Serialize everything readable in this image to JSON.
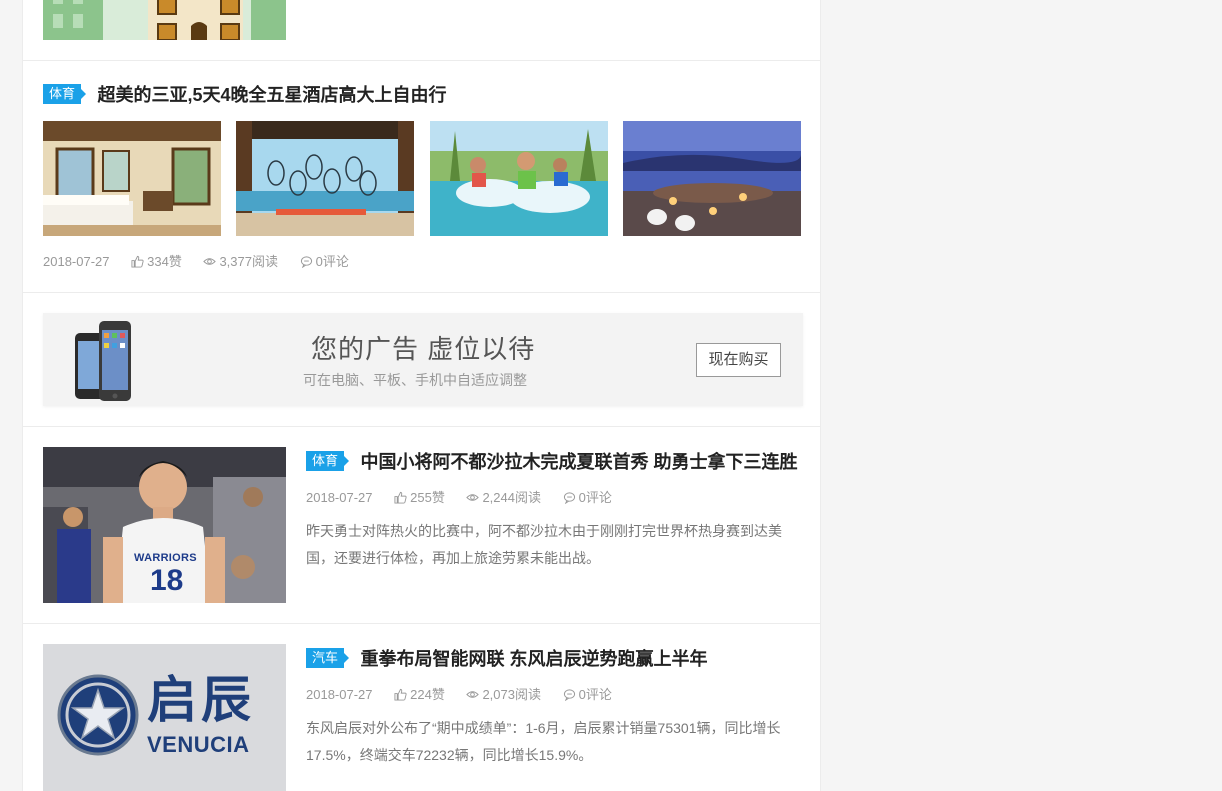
{
  "posts": [
    {
      "category": "体育",
      "title": "超美的三亚,5天4晚全五星酒店高大上自由行",
      "date": "2018-07-27",
      "likes": "334赞",
      "views": "3,377阅读",
      "comments": "0评论"
    },
    {
      "category": "体育",
      "title": "中国小将阿不都沙拉木完成夏联首秀 助勇士拿下三连胜",
      "date": "2018-07-27",
      "likes": "255赞",
      "views": "2,244阅读",
      "comments": "0评论",
      "excerpt": "昨天勇士对阵热火的比赛中，阿不都沙拉木由于刚刚打完世界杯热身赛到达美国，还要进行体检，再加上旅途劳累未能出战。",
      "jersey_team": "WARRIORS",
      "jersey_number": "18"
    },
    {
      "category": "汽车",
      "title": "重拳布局智能网联 东风启辰逆势跑赢上半年",
      "date": "2018-07-27",
      "likes": "224赞",
      "views": "2,073阅读",
      "comments": "0评论",
      "excerpt": "东风启辰对外公布了“期中成绩单”：1-6月，启辰累计销量75301辆，同比增长17.5%，终端交车72232辆，同比增长15.9%。",
      "logo_cn": "启辰",
      "logo_en": "VENUCIA"
    }
  ],
  "ad": {
    "title": "您的广告 虚位以待",
    "subtitle": "可在电脑、平板、手机中自适应调整",
    "button": "现在购买"
  },
  "colors": {
    "accent": "#1aa1e8",
    "meta": "#999999"
  },
  "icons": [
    "thumbs-up-icon",
    "eye-icon",
    "comment-icon"
  ]
}
